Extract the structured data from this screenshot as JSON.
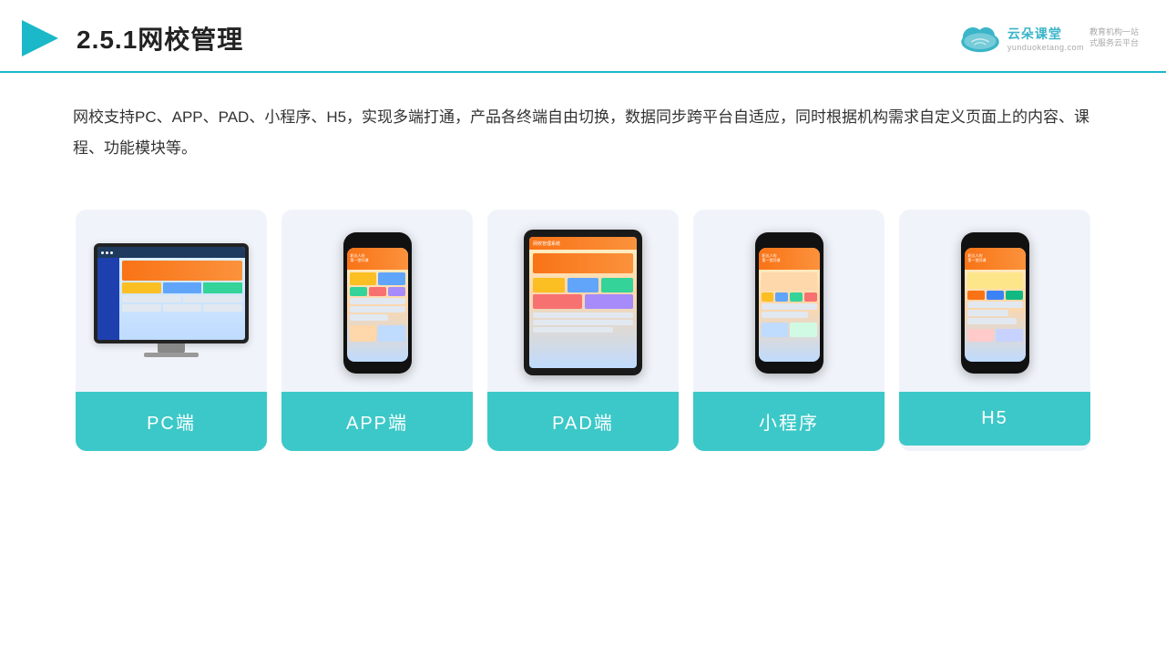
{
  "header": {
    "section_number": "2.5.1",
    "title": "网校管理",
    "logo_name": "云朵课堂",
    "logo_domain": "yunduoketang.com",
    "logo_slogan": "教育机构一站\n式服务云平台"
  },
  "description": {
    "text": "网校支持PC、APP、PAD、小程序、H5，实现多端打通，产品各终端自由切换，数据同步跨平台自适应，同时根据机构需求自定义页面上的内容、课程、功能模块等。"
  },
  "cards": [
    {
      "id": "pc",
      "label": "PC端"
    },
    {
      "id": "app",
      "label": "APP端"
    },
    {
      "id": "pad",
      "label": "PAD端"
    },
    {
      "id": "miniprogram",
      "label": "小程序"
    },
    {
      "id": "h5",
      "label": "H5"
    }
  ],
  "colors": {
    "teal": "#3cc8c8",
    "header_line": "#1ab8c8",
    "bg_card": "#f0f4fa"
  }
}
